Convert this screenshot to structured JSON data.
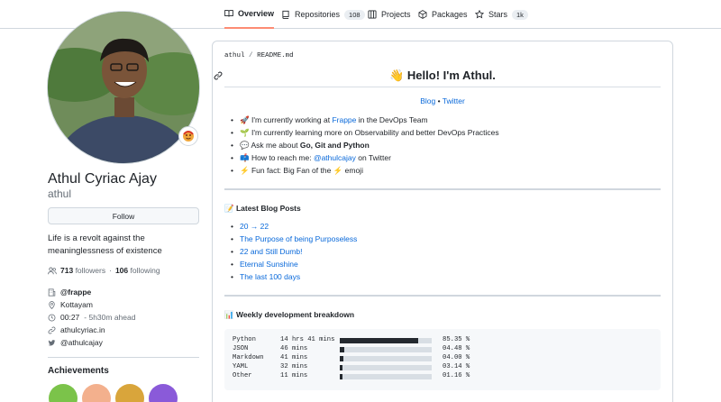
{
  "nav": {
    "tabs": [
      {
        "label": "Overview",
        "icon": "book-icon",
        "active": true
      },
      {
        "label": "Repositories",
        "icon": "repo-icon",
        "count": "108"
      },
      {
        "label": "Projects",
        "icon": "table-icon"
      },
      {
        "label": "Packages",
        "icon": "package-icon"
      },
      {
        "label": "Stars",
        "icon": "star-icon",
        "count": "1k"
      }
    ]
  },
  "profile": {
    "name": "Athul Cyriac Ajay",
    "username": "athul",
    "follow_label": "Follow",
    "bio": "Life is a revolt against the meaninglessness of existence",
    "followers_count": "713",
    "followers_label": "followers",
    "following_count": "106",
    "following_label": "following",
    "org": "@frappe",
    "location": "Kottayam",
    "local_time": "00:27",
    "time_offset": "- 5h30m ahead",
    "website": "athulcyriac.in",
    "twitter": "@athulcajay",
    "achievements_title": "Achievements"
  },
  "readme": {
    "crumb_user": "athul",
    "crumb_sep": "/",
    "crumb_file": "README.md",
    "heading": "👋 Hello! I'm Athul.",
    "link_blog": "Blog",
    "link_sep": "•",
    "link_twitter": "Twitter",
    "about": [
      {
        "emoji": "🚀",
        "pre": "I'm currently working at ",
        "link": "Frappe",
        "post": " in the DevOps Team"
      },
      {
        "emoji": "🌱",
        "pre": "I'm currently learning more on Observability and better DevOps Practices",
        "link": "",
        "post": ""
      },
      {
        "emoji": "💬",
        "pre": "Ask me about ",
        "bold": "Go, Git and Python",
        "link": "",
        "post": ""
      },
      {
        "emoji": "📫",
        "pre": "How to reach me: ",
        "link": "@athulcajay",
        "post": " on Twitter"
      },
      {
        "emoji": "⚡",
        "pre": "Fun fact: Big Fan of the ",
        "post2": "⚡",
        "post": " emoji",
        "link": ""
      }
    ],
    "blog_heading": "📝 Latest Blog Posts",
    "posts": [
      "20 → 22",
      "The Purpose of being Purposeless",
      "22 and Still Dumb!",
      "Eternal Sunshine",
      "The last 100 days"
    ],
    "weekly_heading": "📊 Weekly development breakdown",
    "languages": [
      {
        "name": "Python",
        "time": "14 hrs 41 mins",
        "percent": 85.35,
        "percent_text": "85.35 %"
      },
      {
        "name": "JSON",
        "time": "46 mins",
        "percent": 4.48,
        "percent_text": "04.48 %"
      },
      {
        "name": "Markdown",
        "time": "41 mins",
        "percent": 4.0,
        "percent_text": "04.00 %"
      },
      {
        "name": "YAML",
        "time": "32 mins",
        "percent": 3.14,
        "percent_text": "03.14 %"
      },
      {
        "name": "Other",
        "time": "11 mins",
        "percent": 1.16,
        "percent_text": "01.16 %"
      }
    ]
  },
  "colors": {
    "accent_underline": "#fd8c73",
    "link": "#0969da",
    "muted": "#656d76"
  }
}
